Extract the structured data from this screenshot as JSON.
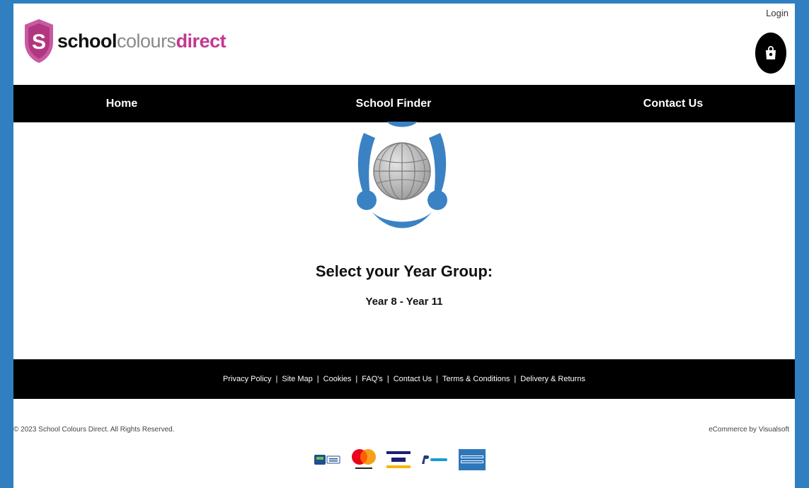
{
  "header": {
    "logo": {
      "part1": "school",
      "part2": "colours",
      "part3": "direct",
      "icon": "shield-s-logo"
    },
    "login_label": "Login",
    "basket_icon": "shopping-bag-icon"
  },
  "nav": {
    "items": [
      {
        "label": "Home"
      },
      {
        "label": "School Finder"
      },
      {
        "label": "Contact Us"
      }
    ]
  },
  "main": {
    "globe_icon": "globe-people-icon",
    "heading": "Select your Year Group:",
    "year_group": "Year 8 - Year 11"
  },
  "footer": {
    "links": [
      {
        "label": "Privacy Policy"
      },
      {
        "label": "Site Map"
      },
      {
        "label": "Cookies"
      },
      {
        "label": "FAQ's"
      },
      {
        "label": "Contact Us"
      },
      {
        "label": "Terms & Conditions"
      },
      {
        "label": "Delivery & Returns"
      }
    ],
    "separator": "|",
    "copyright": "© 2023 School Colours Direct. All Rights Reserved.",
    "credit": "eCommerce by Visualsoft",
    "payment_logos": [
      "pci-dss",
      "mastercard",
      "visa",
      "paypal",
      "american-express"
    ]
  },
  "colors": {
    "frame_blue": "#2f7fc1",
    "brand_pink": "#c2398f",
    "nav_black": "#000000",
    "globe_blue": "#3a82c4"
  }
}
